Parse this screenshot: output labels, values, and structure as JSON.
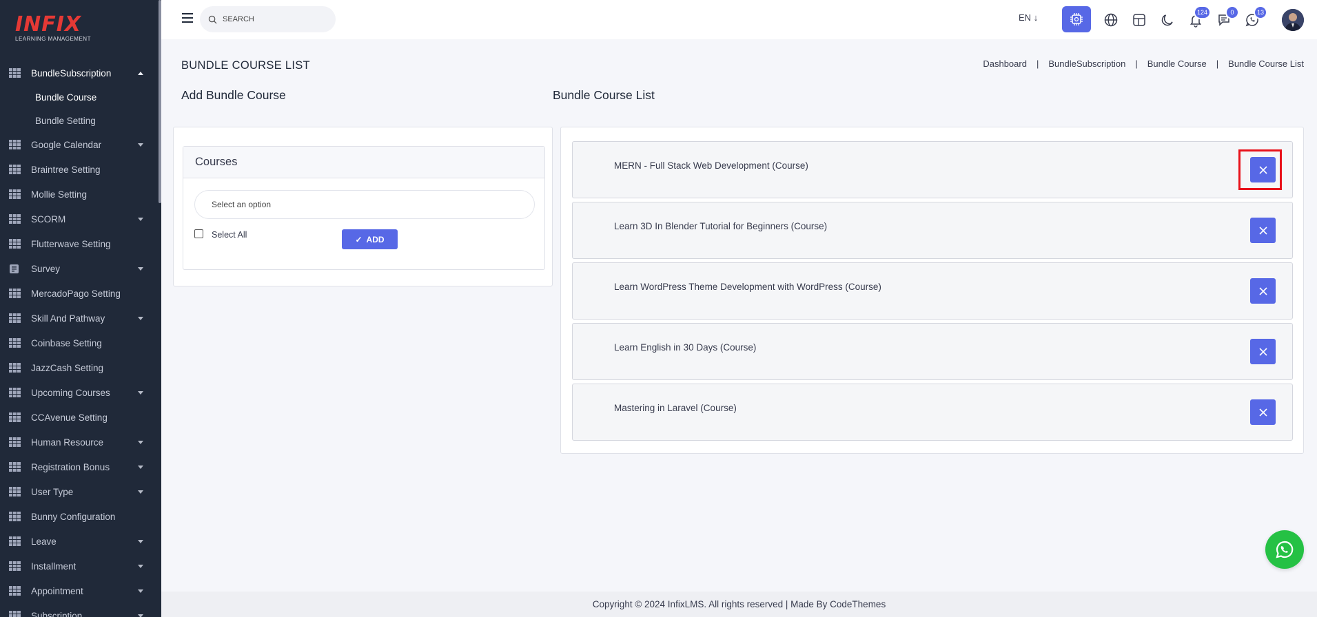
{
  "brand": {
    "logo_text": "INFIX",
    "logo_subtitle": "LEARNING MANAGEMENT"
  },
  "sidebar": {
    "items": [
      {
        "label": "BundleSubscription",
        "icon": "grid-icon",
        "caret": "up",
        "active": true
      },
      {
        "label": "Google Calendar",
        "icon": "grid-icon",
        "caret": "down"
      },
      {
        "label": "Braintree Setting",
        "icon": "grid-icon",
        "caret": ""
      },
      {
        "label": "Mollie Setting",
        "icon": "grid-icon",
        "caret": ""
      },
      {
        "label": "SCORM",
        "icon": "grid-icon",
        "caret": "down"
      },
      {
        "label": "Flutterwave Setting",
        "icon": "grid-icon",
        "caret": ""
      },
      {
        "label": "Survey",
        "icon": "survey-icon",
        "caret": "down"
      },
      {
        "label": "MercadoPago Setting",
        "icon": "grid-icon",
        "caret": ""
      },
      {
        "label": "Skill And Pathway",
        "icon": "grid-icon",
        "caret": "down"
      },
      {
        "label": "Coinbase Setting",
        "icon": "grid-icon",
        "caret": ""
      },
      {
        "label": "JazzCash Setting",
        "icon": "grid-icon",
        "caret": ""
      },
      {
        "label": "Upcoming Courses",
        "icon": "grid-icon",
        "caret": "down"
      },
      {
        "label": "CCAvenue Setting",
        "icon": "grid-icon",
        "caret": ""
      },
      {
        "label": "Human Resource",
        "icon": "grid-icon",
        "caret": "down"
      },
      {
        "label": "Registration Bonus",
        "icon": "grid-icon",
        "caret": "down"
      },
      {
        "label": "User Type",
        "icon": "grid-icon",
        "caret": "down"
      },
      {
        "label": "Bunny Configuration",
        "icon": "grid-icon",
        "caret": ""
      },
      {
        "label": "Leave",
        "icon": "grid-icon",
        "caret": "down"
      },
      {
        "label": "Installment",
        "icon": "grid-icon",
        "caret": "down"
      },
      {
        "label": "Appointment",
        "icon": "grid-icon",
        "caret": "down"
      },
      {
        "label": "Subscription",
        "icon": "grid-icon",
        "caret": "down"
      }
    ],
    "submenu": [
      {
        "label": "Bundle Course",
        "current": true
      },
      {
        "label": "Bundle Setting",
        "current": false
      }
    ]
  },
  "topbar": {
    "search_placeholder": "SEARCH",
    "language": "EN",
    "notifications_count": "124",
    "messages_count": "0",
    "calls_count": "13"
  },
  "page": {
    "title": "BUNDLE COURSE LIST",
    "breadcrumb": [
      "Dashboard",
      "BundleSubscription",
      "Bundle Course",
      "Bundle Course List"
    ],
    "add_section_title": "Add Bundle Course",
    "list_section_title": "Bundle Course List"
  },
  "add_form": {
    "panel_title": "Courses",
    "select_placeholder": "Select an option",
    "select_all_label": "Select All",
    "add_button_label": "ADD"
  },
  "bundle_courses": [
    "MERN - Full Stack Web Development (Course)",
    "Learn 3D In Blender Tutorial for Beginners (Course)",
    "Learn WordPress Theme Development with WordPress (Course)",
    "Learn English in 30 Days (Course)",
    "Mastering in Laravel (Course)"
  ],
  "footer": {
    "copyright": "Copyright © 2024 InfixLMS. All rights reserved | Made By CodeThemes"
  },
  "colors": {
    "sidebar_bg": "#202939",
    "accent": "#5768e6",
    "logo_red": "#e53935",
    "whatsapp": "#25c144",
    "highlight": "#e8111a"
  }
}
